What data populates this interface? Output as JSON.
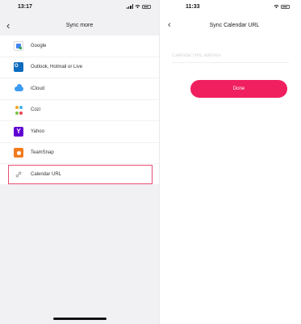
{
  "left_screen": {
    "status_time": "13:17",
    "title": "Sync more",
    "items": [
      {
        "label": "Google",
        "icon": "google-calendar-icon"
      },
      {
        "label": "Outlook, Hotmail or Live",
        "icon": "outlook-icon"
      },
      {
        "label": "iCloud",
        "icon": "icloud-icon"
      },
      {
        "label": "Cozi",
        "icon": "cozi-icon"
      },
      {
        "label": "Yahoo",
        "icon": "yahoo-icon"
      },
      {
        "label": "TeamSnap",
        "icon": "teamsnap-icon"
      },
      {
        "label": "Calendar URL",
        "icon": "link-icon",
        "selected": true
      }
    ],
    "yahoo_glyph": "Y",
    "back_glyph": "‹"
  },
  "right_screen": {
    "status_time": "11:33",
    "title": "Sync Calendar URL",
    "url_input": {
      "value": "",
      "placeholder": "Calendar URL address"
    },
    "done_label": "Done",
    "back_glyph": "‹"
  },
  "colors": {
    "accent": "#f0205f",
    "selection_outline": "#e84f74",
    "list_background": "#f1f1f4"
  }
}
